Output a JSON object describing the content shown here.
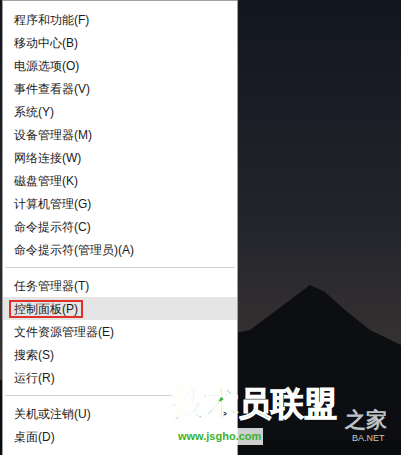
{
  "menu": {
    "items": [
      {
        "kind": "item",
        "label": "程序和功能(F)",
        "selected": false,
        "annotated": false
      },
      {
        "kind": "item",
        "label": "移动中心(B)",
        "selected": false,
        "annotated": false
      },
      {
        "kind": "item",
        "label": "电源选项(O)",
        "selected": false,
        "annotated": false
      },
      {
        "kind": "item",
        "label": "事件查看器(V)",
        "selected": false,
        "annotated": false
      },
      {
        "kind": "item",
        "label": "系统(Y)",
        "selected": false,
        "annotated": false
      },
      {
        "kind": "item",
        "label": "设备管理器(M)",
        "selected": false,
        "annotated": false
      },
      {
        "kind": "item",
        "label": "网络连接(W)",
        "selected": false,
        "annotated": false
      },
      {
        "kind": "item",
        "label": "磁盘管理(K)",
        "selected": false,
        "annotated": false
      },
      {
        "kind": "item",
        "label": "计算机管理(G)",
        "selected": false,
        "annotated": false
      },
      {
        "kind": "item",
        "label": "命令提示符(C)",
        "selected": false,
        "annotated": false
      },
      {
        "kind": "item",
        "label": "命令提示符(管理员)(A)",
        "selected": false,
        "annotated": false
      },
      {
        "kind": "separator",
        "selected": false,
        "annotated": false
      },
      {
        "kind": "item",
        "label": "任务管理器(T)",
        "selected": false,
        "annotated": false
      },
      {
        "kind": "item",
        "label": "控制面板(P)",
        "selected": true,
        "annotated": true
      },
      {
        "kind": "item",
        "label": "文件资源管理器(E)",
        "selected": false,
        "annotated": false
      },
      {
        "kind": "item",
        "label": "搜索(S)",
        "selected": false,
        "annotated": false
      },
      {
        "kind": "item",
        "label": "运行(R)",
        "selected": false,
        "annotated": false
      },
      {
        "kind": "separator",
        "selected": false,
        "annotated": false
      },
      {
        "kind": "submenu",
        "label": "关机或注销(U)",
        "arrow": ">",
        "selected": false,
        "annotated": false
      },
      {
        "kind": "item",
        "label": "桌面(D)",
        "selected": false,
        "annotated": false
      }
    ]
  },
  "watermark": {
    "title": "技术员联盟",
    "url": "www.jsgho.com",
    "back": "之家",
    "domain": "BA.NET"
  }
}
